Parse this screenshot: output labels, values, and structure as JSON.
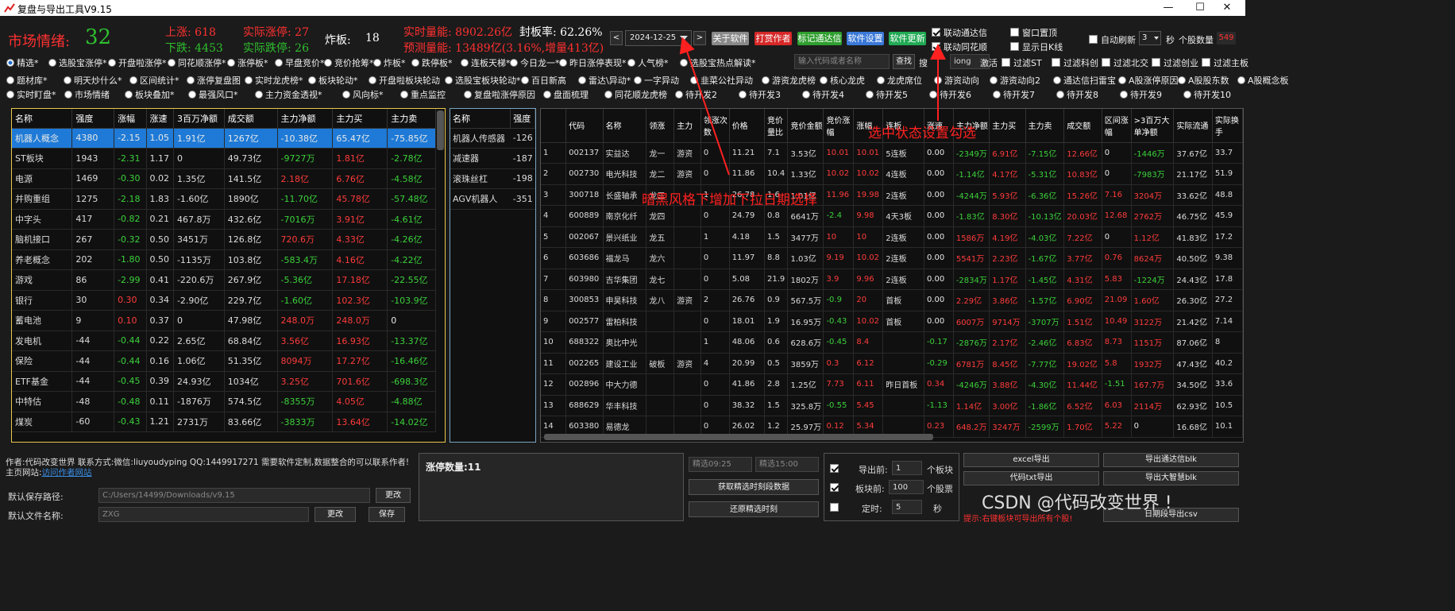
{
  "window": {
    "title": "复盘与导出工具V9.15",
    "minimize": "—",
    "maximize": "☐",
    "close": "✕"
  },
  "summary": {
    "sentiment_label": "市场情绪:",
    "sentiment_value": "32",
    "up_label": "上涨: 618",
    "down_label": "下跌: 4453",
    "limit_up_label": "实际涨停: 27",
    "limit_down_label": "实际跌停: 26",
    "broken_label": "炸板:",
    "broken_value": "18",
    "volume_label": "实时量能: 8902.26亿",
    "seal_rate_label": "封板率: 62.26%",
    "forecast_label": "预测量能: 13489亿(3.16%,增量413亿)"
  },
  "toolbar": {
    "prev": "<",
    "date": "2024-12-25",
    "next": ">",
    "buttons": [
      {
        "label": "关于软件",
        "color": "#8a8a8a"
      },
      {
        "label": "打赏作者",
        "color": "#d62828"
      },
      {
        "label": "标记通达信",
        "color": "#2f9e2f"
      },
      {
        "label": "软件设置",
        "color": "#3a78d8"
      },
      {
        "label": "软件更新",
        "color": "#22aa55"
      }
    ],
    "options": [
      {
        "label": "联动通达信",
        "checked": true
      },
      {
        "label": "窗口置顶",
        "checked": false
      },
      {
        "label": "联动同花顺",
        "checked": true
      },
      {
        "label": "显示日K线",
        "checked": false
      }
    ],
    "auto_refresh": "自动刷新",
    "refresh_value": "3",
    "refresh_unit": "秒",
    "stock_count_label": "个股数量",
    "stock_count": "549"
  },
  "tabs_row1": [
    "精选*",
    "选股宝涨停*",
    "开盘啦涨停*",
    "同花顺涨停*",
    "涨停板*",
    "早盘竞价*",
    "竞价抢筹*",
    "炸板*",
    "跌停板*",
    "连板天梯*",
    "今日龙一*",
    "昨日涨停表现*",
    "人气榜*",
    "选股宝热点解读*"
  ],
  "search": {
    "placeholder": "输入代码或者名称",
    "button": "查找",
    "search_tail": "搜 ",
    "search_input": "iong",
    "activate": "激活"
  },
  "filters": [
    "过滤ST",
    "过滤科创",
    "过滤北交",
    "过滤创业",
    "过滤主板"
  ],
  "tabs_row2": [
    "题材库*",
    "明天炒什么*",
    "区间统计*",
    "涨停复盘图",
    "实时龙虎榜*",
    "板块轮动*",
    "开盘啦板块轮动",
    "选股宝板块轮动*",
    "百日新高",
    "雷达\\异动*",
    "一字异动",
    "韭菜公社异动",
    "游资龙虎榜",
    "核心龙虎",
    "龙虎席位",
    "游资动向",
    "游资动向2",
    "通达信扫雷宝",
    "A股涨停原因",
    "A股股东数",
    "A股概念板"
  ],
  "tabs_row3": [
    "实时盯盘*",
    "市场情绪",
    "板块叠加*",
    "最强风口*",
    "主力资金透视*",
    "风向标*",
    "重点监控",
    "复盘啦涨停原因",
    "盘面梳理",
    "同花顺龙虎榜",
    "待开发2",
    "待开发3",
    "待开发4",
    "待开发5",
    "待开发6",
    "待开发7",
    "待开发8",
    "待开发9",
    "待开发10"
  ],
  "sector_table": {
    "headers": [
      "名称",
      "强度",
      "涨幅",
      "涨速",
      "3百万净额",
      "成交额",
      "主力净额",
      "主力买",
      "主力卖"
    ],
    "rows": [
      [
        "机器人概念",
        "4380",
        "-2.15",
        "1.05",
        "1.91亿",
        "1267亿",
        "-10.38亿",
        "65.47亿",
        "-75.85亿"
      ],
      [
        "ST板块",
        "1943",
        "-2.31",
        "1.17",
        "0",
        "49.73亿",
        "-9727万",
        "1.81亿",
        "-2.78亿"
      ],
      [
        "电源",
        "1469",
        "-0.30",
        "0.02",
        "1.35亿",
        "141.5亿",
        "2.18亿",
        "6.76亿",
        "-4.58亿"
      ],
      [
        "并购重组",
        "1275",
        "-2.18",
        "1.83",
        "-1.60亿",
        "1890亿",
        "-11.70亿",
        "45.78亿",
        "-57.48亿"
      ],
      [
        "中字头",
        "417",
        "-0.82",
        "0.21",
        "467.8万",
        "432.6亿",
        "-7016万",
        "3.91亿",
        "-4.61亿"
      ],
      [
        "脑机接口",
        "267",
        "-0.32",
        "0.50",
        "3451万",
        "126.8亿",
        "720.6万",
        "4.33亿",
        "-4.26亿"
      ],
      [
        "养老概念",
        "202",
        "-1.80",
        "0.50",
        "-1135万",
        "103.8亿",
        "-583.4万",
        "4.16亿",
        "-4.22亿"
      ],
      [
        "游戏",
        "86",
        "-2.99",
        "0.41",
        "-220.6万",
        "267.9亿",
        "-5.36亿",
        "17.18亿",
        "-22.55亿"
      ],
      [
        "银行",
        "30",
        "0.30",
        "0.34",
        "-2.90亿",
        "229.7亿",
        "-1.60亿",
        "102.3亿",
        "-103.9亿"
      ],
      [
        "蓄电池",
        "9",
        "0.10",
        "0.37",
        "0",
        "47.98亿",
        "248.0万",
        "248.0万",
        "0"
      ],
      [
        "发电机",
        "-44",
        "-0.44",
        "0.22",
        "2.65亿",
        "68.84亿",
        "3.56亿",
        "16.93亿",
        "-13.37亿"
      ],
      [
        "保险",
        "-44",
        "-0.44",
        "0.16",
        "1.06亿",
        "51.35亿",
        "8094万",
        "17.27亿",
        "-16.46亿"
      ],
      [
        "ETF基金",
        "-44",
        "-0.45",
        "0.39",
        "24.93亿",
        "1034亿",
        "3.25亿",
        "701.6亿",
        "-698.3亿"
      ],
      [
        "中特估",
        "-48",
        "-0.48",
        "0.11",
        "-1876万",
        "574.5亿",
        "-8355万",
        "4.05亿",
        "-4.88亿"
      ],
      [
        "煤炭",
        "-60",
        "-0.43",
        "1.21",
        "2731万",
        "83.66亿",
        "-3833万",
        "13.64亿",
        "-14.02亿"
      ]
    ]
  },
  "sub_table": {
    "headers": [
      "名称",
      "强度"
    ],
    "rows": [
      [
        "机器人传感器",
        "-126"
      ],
      [
        "减速器",
        "-187"
      ],
      [
        "滚珠丝杠",
        "-198"
      ],
      [
        "AGV机器人",
        "-351"
      ]
    ]
  },
  "stock_table": {
    "headers": [
      "",
      "代码",
      "名称",
      "领涨",
      "主力",
      "领涨次数",
      "价格",
      "竞价量比",
      "竞价金额",
      "竞价涨幅",
      "涨幅",
      "连板",
      "涨速",
      "主力净额",
      "主力买",
      "主力卖",
      "成交额",
      "区间涨幅",
      ">3百万大单净额",
      "实际流通",
      "实际换手"
    ],
    "rows": [
      [
        "1",
        "002137",
        "实益达",
        "龙一",
        "游资",
        "0",
        "11.21",
        "7.1",
        "3.53亿",
        "10.01",
        "10.01",
        "5连板",
        "0.00",
        "-2349万",
        "6.91亿",
        "-7.15亿",
        "12.66亿",
        "0",
        "-1446万",
        "37.67亿",
        "33.7"
      ],
      [
        "2",
        "002730",
        "电光科技",
        "龙二",
        "游资",
        "0",
        "11.86",
        "10.4",
        "1.33亿",
        "10.02",
        "10.02",
        "4连板",
        "0.00",
        "-1.14亿",
        "4.17亿",
        "-5.31亿",
        "10.83亿",
        "0",
        "-7983万",
        "21.17亿",
        "51.9"
      ],
      [
        "3",
        "300718",
        "长盛轴承",
        "龙三",
        "",
        "1",
        "26.78",
        "1.6",
        "1.01亿",
        "11.96",
        "19.98",
        "2连板",
        "0.00",
        "-4244万",
        "5.93亿",
        "-6.36亿",
        "15.26亿",
        "7.16",
        "3204万",
        "33.62亿",
        "48.8"
      ],
      [
        "4",
        "600889",
        "南京化纤",
        "龙四",
        "",
        "0",
        "24.79",
        "0.8",
        "6641万",
        "-2.4",
        "9.98",
        "4天3板",
        "0.00",
        "-1.83亿",
        "8.30亿",
        "-10.13亿",
        "20.03亿",
        "12.68",
        "2762万",
        "46.75亿",
        "45.9"
      ],
      [
        "5",
        "002067",
        "景兴纸业",
        "龙五",
        "",
        "1",
        "4.18",
        "1.5",
        "3477万",
        "10",
        "10",
        "2连板",
        "0.00",
        "1586万",
        "4.19亿",
        "-4.03亿",
        "7.22亿",
        "0",
        "1.12亿",
        "41.83亿",
        "17.2"
      ],
      [
        "6",
        "603686",
        "福龙马",
        "龙六",
        "",
        "0",
        "11.97",
        "8.8",
        "1.03亿",
        "9.19",
        "10.02",
        "2连板",
        "0.00",
        "5541万",
        "2.23亿",
        "-1.67亿",
        "3.77亿",
        "0.76",
        "8624万",
        "40.50亿",
        "9.38"
      ],
      [
        "7",
        "603980",
        "吉华集团",
        "龙七",
        "",
        "0",
        "5.08",
        "21.9",
        "1802万",
        "3.9",
        "9.96",
        "2连板",
        "0.00",
        "-2834万",
        "1.17亿",
        "-1.45亿",
        "4.31亿",
        "5.83",
        "-1224万",
        "24.43亿",
        "17.8"
      ],
      [
        "8",
        "300853",
        "申昊科技",
        "龙八",
        "游资",
        "2",
        "26.76",
        "0.9",
        "567.5万",
        "-0.9",
        "20",
        "首板",
        "0.00",
        "2.29亿",
        "3.86亿",
        "-1.57亿",
        "6.90亿",
        "21.09",
        "1.60亿",
        "26.30亿",
        "27.2"
      ],
      [
        "9",
        "002577",
        "雷柏科技",
        "",
        "",
        "0",
        "18.01",
        "1.9",
        "16.95万",
        "-0.43",
        "10.02",
        "首板",
        "0.00",
        "6007万",
        "9714万",
        "-3707万",
        "1.51亿",
        "10.49",
        "3122万",
        "21.42亿",
        "7.14"
      ],
      [
        "10",
        "688322",
        "奥比中光",
        "",
        "",
        "1",
        "48.06",
        "0.6",
        "628.6万",
        "-0.45",
        "8.4",
        "",
        "-0.17",
        "-2876万",
        "2.17亿",
        "-2.46亿",
        "6.83亿",
        "8.73",
        "1151万",
        "87.06亿",
        "8"
      ],
      [
        "11",
        "002265",
        "建设工业",
        "破板",
        "游资",
        "4",
        "20.99",
        "0.5",
        "3859万",
        "0.3",
        "6.12",
        "",
        "-0.29",
        "6781万",
        "8.45亿",
        "-7.77亿",
        "19.02亿",
        "5.8",
        "1932万",
        "47.43亿",
        "40.2"
      ],
      [
        "12",
        "002896",
        "中大力德",
        "",
        "",
        "0",
        "41.86",
        "2.8",
        "1.25亿",
        "7.73",
        "6.11",
        "昨日首板",
        "0.34",
        "-4246万",
        "3.88亿",
        "-4.30亿",
        "11.44亿",
        "-1.51",
        "167.7万",
        "34.50亿",
        "33.6"
      ],
      [
        "13",
        "688629",
        "华丰科技",
        "",
        "",
        "0",
        "38.32",
        "1.5",
        "325.8万",
        "-0.55",
        "5.45",
        "",
        "-1.13",
        "1.14亿",
        "3.00亿",
        "-1.86亿",
        "6.52亿",
        "6.03",
        "2114万",
        "62.93亿",
        "10.5"
      ],
      [
        "14",
        "603380",
        "易德龙",
        "",
        "",
        "0",
        "26.02",
        "1.2",
        "25.97万",
        "0.12",
        "5.34",
        "",
        "0.23",
        "648.2万",
        "3247万",
        "-2599万",
        "1.70亿",
        "5.22",
        "0",
        "16.68亿",
        "10.1"
      ]
    ]
  },
  "annotations": {
    "date_note": "暗黑风格下增加下拉日期选择",
    "check_note": "选中状态设置勾选"
  },
  "footer": {
    "author": "作者:代码改变世界 联系方式:微信:liuyoudyping QQ:1449917271 需要软件定制,数据整合的可以联系作者!主页网站:",
    "visit": "访问作者网站",
    "save_path_label": "默认保存路径:",
    "save_path": "C:/Users/14499/Downloads/v9.15",
    "change": "更改",
    "file_name_label": "默认文件名称:",
    "file_name": "ZXG",
    "change2": "更改",
    "save": "保存",
    "limit_count": "涨停数量:11",
    "time_start": "精选09:25",
    "time_end": "精选15:00",
    "fetch": "获取精选时刻段数据",
    "restore": "还原精选时刻",
    "export_before_label": "导出前:",
    "export_before_value": "1",
    "export_before_unit": "个板块",
    "block_before_label": "板块前:",
    "block_before_value": "100",
    "block_before_unit": "个股票",
    "timer_label": "定时:",
    "timer_value": "5",
    "timer_unit": "秒",
    "excel": "excel导出",
    "tdx": "导出通达信blk",
    "txt": "代码txt导出",
    "dzh": "导出大智慧blk",
    "csv": "日期段导出csv",
    "hint": "提示:右键板块可导出所有个股!",
    "watermark": "CSDN @代码改变世界 !"
  }
}
